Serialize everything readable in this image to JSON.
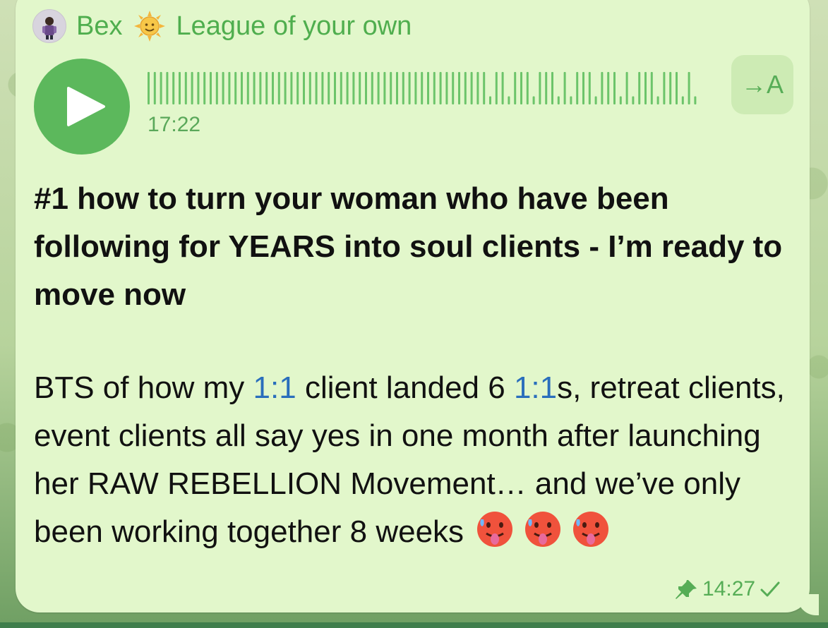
{
  "header": {
    "sender_name": "Bex",
    "channel_name": "League of your own"
  },
  "voice_message": {
    "duration": "17:22",
    "transcribe_label": "→A",
    "progress": 0
  },
  "message": {
    "title": "#1 how to turn your woman who have been following for YEARS into soul clients - I’m ready to move now",
    "body_parts": {
      "p1": "BTS of how my ",
      "link1": "1:1",
      "p2": " client landed 6 ",
      "link2": "1:1",
      "p3": "s, retreat clients, event clients all say yes in one month after launching her RAW REBELLION Movement… and we’ve only been working together 8 weeks"
    },
    "emoji": [
      "hot-face",
      "hot-face",
      "hot-face"
    ]
  },
  "status": {
    "time": "14:27",
    "pinned": true,
    "read_state": "sent"
  },
  "colors": {
    "bubble": "#e2f7cb",
    "accent_green": "#5cb85c",
    "link_blue": "#2a6ebc"
  }
}
